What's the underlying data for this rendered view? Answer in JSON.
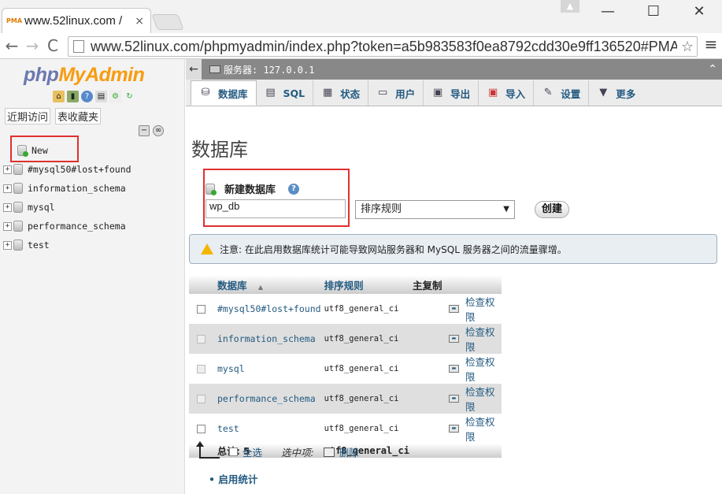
{
  "browser": {
    "tab_title": "www.52linux.com /",
    "tab_close": "×",
    "favicon_text": "PMA",
    "url": "www.52linux.com/phpmyadmin/index.php?token=a5b983583f0ea8792cdd30e9ff136520#PMAURL",
    "window_minimize": "—",
    "window_maximize": "☐",
    "window_close": "✕",
    "nav_back": "←",
    "nav_forward": "→",
    "nav_reload": "C",
    "star": "☆",
    "menu": "≡"
  },
  "sidebar": {
    "logo_php": "php",
    "logo_my": "My",
    "logo_admin": "Admin",
    "recent": "近期访问",
    "favorites": "表收藏夹",
    "new_item": "New",
    "databases": [
      "#mysql50#lost+found",
      "information_schema",
      "mysql",
      "performance_schema",
      "test"
    ]
  },
  "server_bar": {
    "label": "服务器: 127.0.0.1"
  },
  "tabs": [
    {
      "label": "数据库",
      "icon": "database-icon",
      "active": true
    },
    {
      "label": "SQL",
      "icon": "sql-icon"
    },
    {
      "label": "状态",
      "icon": "status-icon"
    },
    {
      "label": "用户",
      "icon": "users-icon"
    },
    {
      "label": "导出",
      "icon": "export-icon"
    },
    {
      "label": "导入",
      "icon": "import-icon"
    },
    {
      "label": "设置",
      "icon": "settings-icon"
    },
    {
      "label": "更多",
      "icon": "chevron-down-icon"
    }
  ],
  "main": {
    "title": "数据库",
    "create_label": "新建数据库",
    "db_name_value": "wp_db",
    "collation_placeholder": "排序规则",
    "create_button": "创建",
    "notice": "注意: 在此启用数据库统计可能导致网站服务器和 MySQL 服务器之间的流量骤增。",
    "table_headers": [
      "数据库",
      "排序规则",
      "主复制"
    ],
    "sort_indicator": "▲",
    "rows": [
      {
        "name": "#mysql50#lost+found",
        "collation": "utf8_general_ci",
        "action": "检查权限"
      },
      {
        "name": "information_schema",
        "collation": "utf8_general_ci",
        "action": "检查权限"
      },
      {
        "name": "mysql",
        "collation": "utf8_general_ci",
        "action": "检查权限"
      },
      {
        "name": "performance_schema",
        "collation": "utf8_general_ci",
        "action": "检查权限"
      },
      {
        "name": "test",
        "collation": "utf8_general_ci",
        "action": "检查权限"
      }
    ],
    "total_label": "总计: 5",
    "total_collation": "utf8_general_ci",
    "select_all": "全选",
    "with_selected": "选中项:",
    "delete": "删除",
    "enable_stats": "启用统计"
  },
  "colors": {
    "link": "#235a81",
    "highlight_box": "#e03030",
    "server_bar": "#888888"
  }
}
